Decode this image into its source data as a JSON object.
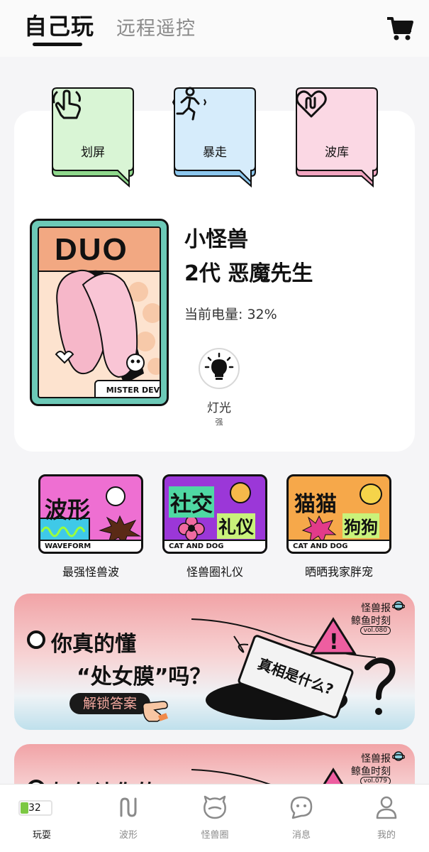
{
  "header": {
    "tabs": [
      {
        "label": "自己玩",
        "active": true
      },
      {
        "label": "远程遥控",
        "active": false
      }
    ],
    "cart_icon": "shopping-cart-icon"
  },
  "modes": [
    {
      "label": "划屏",
      "icon": "swipe-hand-icon",
      "color": "#d9f5d5",
      "shadow": "#8fd88c"
    },
    {
      "label": "暴走",
      "icon": "running-person-icon",
      "color": "#d6ecfb",
      "shadow": "#8cc7ee"
    },
    {
      "label": "波库",
      "icon": "heart-wave-icon",
      "color": "#fbd8e4",
      "shadow": "#f2a6c1"
    }
  ],
  "device": {
    "poster_title": "DUO",
    "poster_badge": "MISTER DEVIL",
    "name_line1": "小怪兽",
    "name_line2": "2代 恶魔先生",
    "battery_label": "当前电量: 32%",
    "light": {
      "label": "灯光",
      "level": "强",
      "icon": "light-bulb-icon"
    }
  },
  "features": [
    {
      "title": "波形",
      "subtitle": "",
      "bar": "WAVEFORM",
      "caption": "最强怪兽波",
      "bg": "#ee6fd2"
    },
    {
      "title": "社交",
      "subtitle": "礼仪",
      "bar": "CAT AND DOG",
      "caption": "怪兽圈礼仪",
      "bg": "#9b37d8"
    },
    {
      "title": "猫猫",
      "subtitle": "狗狗",
      "bar": "CAT AND DOG",
      "caption": "晒晒我家胖宠",
      "bg": "#f6a84a"
    }
  ],
  "banners": [
    {
      "line1": "你真的懂",
      "line2": "“处女膜”吗？",
      "button": "解锁答案",
      "card": "真相是什么?",
      "brand1": "怪兽报",
      "brand2": "鲸鱼时刻",
      "vol": "vol.080"
    },
    {
      "line1": "如何让你的",
      "brand1": "怪兽报",
      "brand2": "鲸鱼时刻",
      "vol": "vol.079"
    }
  ],
  "bottom_nav": {
    "battery_value": "32",
    "items": [
      {
        "label": "玩耍",
        "icon": "battery-icon",
        "active": true
      },
      {
        "label": "波形",
        "icon": "wave-icon",
        "active": false
      },
      {
        "label": "怪兽圈",
        "icon": "monster-face-icon",
        "active": false
      },
      {
        "label": "消息",
        "icon": "chat-bubble-icon",
        "active": false
      },
      {
        "label": "我的",
        "icon": "user-icon",
        "active": false
      }
    ]
  }
}
